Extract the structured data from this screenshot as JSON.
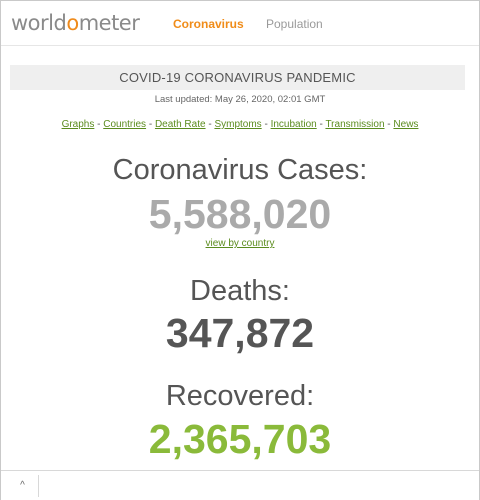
{
  "nav": {
    "logo_pre": "world",
    "logo_o": "o",
    "logo_post": "meter",
    "coronavirus": "Coronavirus",
    "population": "Population"
  },
  "header": {
    "title": "COVID-19 CORONAVIRUS PANDEMIC",
    "last_updated": "Last updated: May 26, 2020, 02:01 GMT"
  },
  "links": {
    "items": [
      "Graphs",
      "Countries",
      "Death Rate",
      "Symptoms",
      "Incubation",
      "Transmission",
      "News"
    ],
    "separator": " - "
  },
  "stats": {
    "cases_label": "Coronavirus Cases:",
    "cases_value": "5,588,020",
    "view_by_country": "view by country",
    "deaths_label": "Deaths:",
    "deaths_value": "347,872",
    "recovered_label": "Recovered:",
    "recovered_value": "2,365,703"
  },
  "colors": {
    "brand_orange": "#f08c19",
    "link_green": "#5b8c1e",
    "cases_gray": "#aaaaaa",
    "deaths_dark": "#555555",
    "recovered_green": "#8aba3a"
  },
  "bottom_bar": {
    "up_icon": "chevron-up-icon",
    "up_glyph": "^"
  }
}
